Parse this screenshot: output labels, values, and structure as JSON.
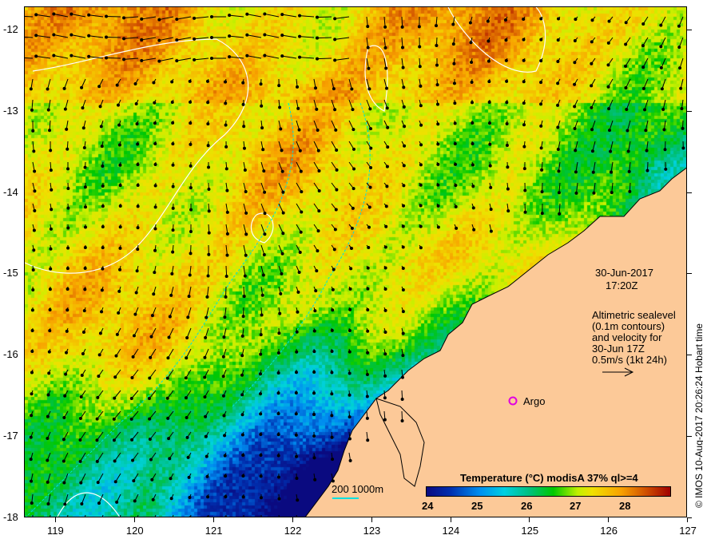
{
  "x_axis": {
    "ticks": [
      "119",
      "120",
      "121",
      "122",
      "123",
      "124",
      "125",
      "126",
      "127"
    ]
  },
  "y_axis": {
    "ticks": [
      "-12",
      "-13",
      "-14",
      "-15",
      "-16",
      "-17",
      "-18"
    ]
  },
  "annotation": {
    "date": "30-Jun-2017",
    "time": "17:20Z",
    "lines": [
      "Altimetric sealevel",
      "(0.1m contours)",
      "and velocity for",
      "30-Jun 17Z",
      "0.5m/s (1kt 24h)"
    ]
  },
  "argo_label": "Argo",
  "scale_bar": {
    "label": "200  1000m"
  },
  "colorbar": {
    "title": "Temperature (°C) modisA 37% ql>=4",
    "ticks": [
      "24",
      "25",
      "26",
      "27",
      "28"
    ],
    "range": [
      24,
      28.9
    ]
  },
  "credit": "© IMOS 10-Aug-2017 20:26:24 Hobart time",
  "colors": {
    "land": "#fcc998",
    "contour": "#ffffff",
    "bathymetry": "#00e5e5",
    "argo": "#e000e0"
  }
}
